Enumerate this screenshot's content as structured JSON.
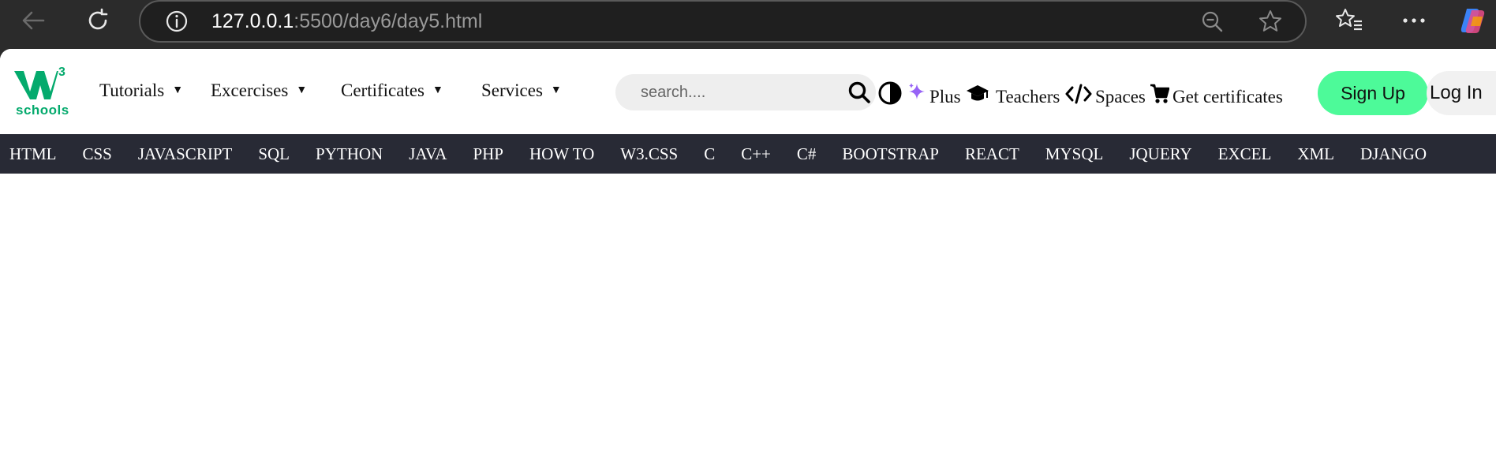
{
  "browser": {
    "url_host": "127.0.0.1",
    "url_rest": ":5500/day6/day5.html",
    "icons": [
      "back-arrow-icon",
      "reload-icon",
      "site-info-icon",
      "zoom-out-icon",
      "favorite-star-icon",
      "favorites-list-icon",
      "more-icon",
      "copilot-icon"
    ]
  },
  "logo": {
    "superscript": "3",
    "sub": "schools",
    "color": "#04aa6d"
  },
  "menus": [
    {
      "label": "Tutorials",
      "caret": "▼"
    },
    {
      "label": "Excercises",
      "caret": "▼"
    },
    {
      "label": "Certificates",
      "caret": "▼"
    },
    {
      "label": "Services",
      "caret": "▼"
    }
  ],
  "search": {
    "placeholder": "search...."
  },
  "links": {
    "plus": "Plus",
    "teachers": "Teachers",
    "spaces": "Spaces",
    "certs": "Get certificates"
  },
  "auth": {
    "signup": "Sign Up",
    "login": "Log In"
  },
  "subjects": [
    "HTML",
    "CSS",
    "JAVASCRIPT",
    "SQL",
    "PYTHON",
    "JAVA",
    "PHP",
    "HOW TO",
    "W3.CSS",
    "C",
    "C++",
    "C#",
    "BOOTSTRAP",
    "REACT",
    "MYSQL",
    "JQUERY",
    "EXCEL",
    "XML",
    "DJANGO"
  ],
  "colors": {
    "accent": "#04aa6d",
    "signup_bg": "#4dfa99",
    "subject_bar": "#282a35",
    "plus_sparkle": "#9763f6"
  }
}
